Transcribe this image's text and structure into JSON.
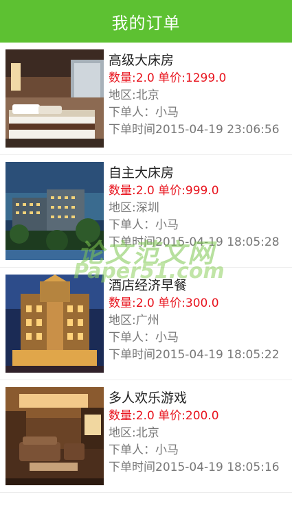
{
  "header": {
    "title": "我的订单"
  },
  "orders": [
    {
      "name": "高级大床房",
      "price_line": "数量:2.0 单价:1299.0",
      "region": "地区:北京",
      "buyer": "下单人：小马",
      "time": "下单时间2015-04-19 23:06:56",
      "image": "hotel-room-icon"
    },
    {
      "name": "自主大床房",
      "price_line": "数量:2.0 单价:999.0",
      "region": "地区:深圳",
      "buyer": "下单人：小马",
      "time": "下单时间2015-04-19 18:05:28",
      "image": "hotel-building-icon"
    },
    {
      "name": "酒店经济早餐",
      "price_line": "数量:2.0 单价:300.0",
      "region": "地区:广州",
      "buyer": "下单人：小马",
      "time": "下单时间2015-04-19 18:05:22",
      "image": "hotel-night-icon"
    },
    {
      "name": "多人欢乐游戏",
      "price_line": "数量:2.0 单价:200.0",
      "region": "地区:北京",
      "buyer": "下单人：小马",
      "time": "下单时间2015-04-19 18:05:16",
      "image": "lounge-icon"
    }
  ],
  "watermark": {
    "line1": "论文范文网",
    "line2": "Paper51.com"
  },
  "colors": {
    "header_bg": "#5dc132",
    "price_red": "#e8141e",
    "meta_gray": "#777777"
  }
}
